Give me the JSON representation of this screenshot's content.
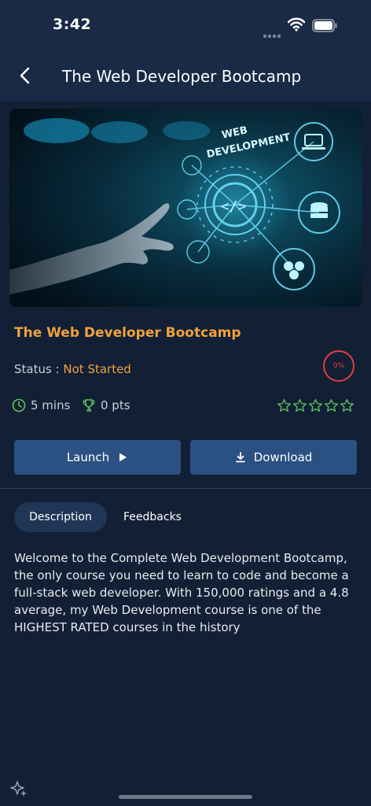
{
  "status_bar": {
    "time": "3:42"
  },
  "header": {
    "title": "The Web Developer Bootcamp",
    "back_icon": "chevron-left-icon"
  },
  "hero": {
    "overlay_text_line1": "WEB",
    "overlay_text_line2": "DEVELOPMENT"
  },
  "course": {
    "title": "The Web Developer Bootcamp",
    "status_label": "Status : ",
    "status_value": "Not Started",
    "progress_label": "0%",
    "progress_value": 0,
    "duration": "5 mins",
    "points": "0 pts",
    "rating": 0,
    "rating_max": 5
  },
  "actions": {
    "launch_label": "Launch",
    "download_label": "Download"
  },
  "tabs": [
    {
      "label": "Description",
      "active": true
    },
    {
      "label": "Feedbacks",
      "active": false
    }
  ],
  "description": "Welcome to the Complete Web Development Bootcamp, the only course you need to learn to code and become a full-stack web developer. With 150,000 ratings and a 4.8 average, my Web Development course is one of the HIGHEST RATED courses in the history",
  "colors": {
    "accent": "#f0a23c",
    "button": "#2a5182",
    "success": "#5fc35a",
    "danger": "#e0403c",
    "background": "#131f35"
  }
}
